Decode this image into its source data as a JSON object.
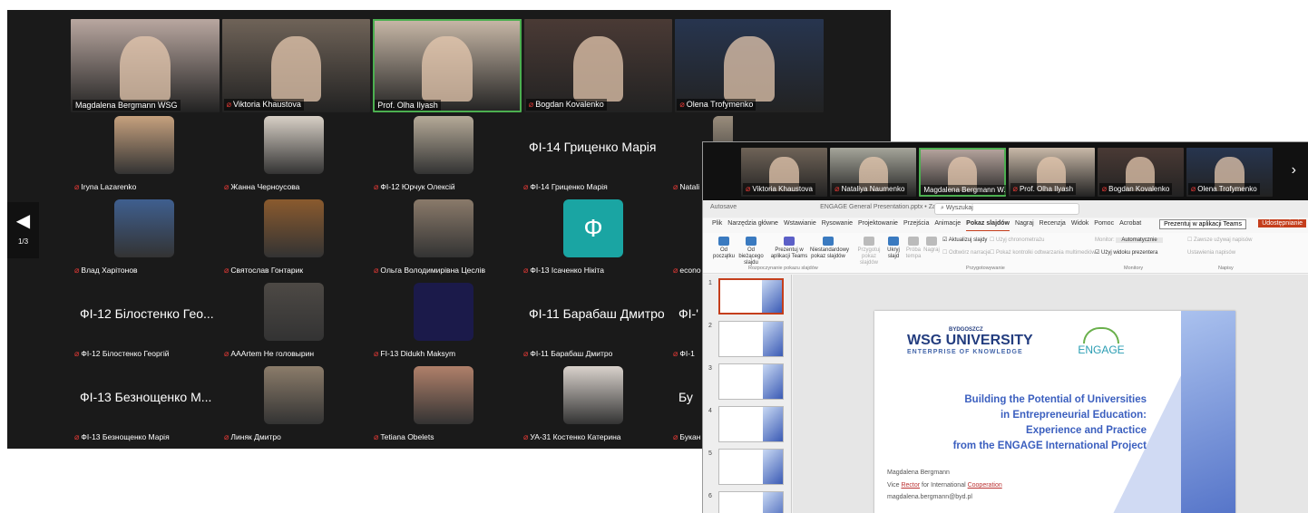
{
  "zoom_call": {
    "pager": "1/3",
    "top_row": [
      {
        "name": "Magdalena Bergmann WSG",
        "muted": false,
        "active": false,
        "bg": "#b9a7a0"
      },
      {
        "name": "Viktoria Khaustova",
        "muted": true,
        "active": false,
        "bg": "#6f6358"
      },
      {
        "name": "Prof. Olha Ilyash",
        "muted": false,
        "active": true,
        "bg": "#c9b9a8"
      },
      {
        "name": "Bogdan Kovalenko",
        "muted": true,
        "active": false,
        "bg": "#4a3a35"
      },
      {
        "name": "Olena Trofymenko",
        "muted": true,
        "active": false,
        "bg": "#27354f"
      }
    ],
    "grid": [
      {
        "label": "Iryna Lazarenko",
        "big": "",
        "photo": "#c6a17e"
      },
      {
        "label": "Жанна Черноусова",
        "big": "",
        "photo": "#d8d0c6"
      },
      {
        "label": "ФІ-12 Юрчук Олексій",
        "big": "",
        "photo": "#b5aa98"
      },
      {
        "label": "ФІ-14 Гриценко Марія",
        "big": "ФІ-14 Гриценко Марія",
        "photo": ""
      },
      {
        "label": "Natali",
        "big": "",
        "photo": "#9a8d7c"
      },
      {
        "label": "Влад Харітонов",
        "big": "",
        "photo": "#3f5f8f"
      },
      {
        "label": "Святослав Гонтарик",
        "big": "",
        "photo": "#8a5a2e"
      },
      {
        "label": "Ольга Володимирівна Цеслів",
        "big": "",
        "photo": "#8a7a6a"
      },
      {
        "label": "ФІ-13 Ісаченко Нікіта",
        "big": "",
        "photo": "teal"
      },
      {
        "label": "econo",
        "big": "",
        "photo": ""
      },
      {
        "label": "ФІ-12 Білостенко Георгій",
        "big": "ФІ-12 Білостенко Гео...",
        "photo": ""
      },
      {
        "label": "AAArtem Не головырин",
        "big": "",
        "photo": "#4d4945"
      },
      {
        "label": "FI-13 Didukh Maksym",
        "big": "",
        "photo": "navy"
      },
      {
        "label": "ФІ-11 Барабаш Дмитро",
        "big": "ФІ-11 Барабаш Дмитро",
        "photo": ""
      },
      {
        "label": "ФІ-1",
        "big": "ФІ-'",
        "photo": ""
      },
      {
        "label": "ФІ-13 Безнощенко Марія",
        "big": "ФІ-13 Безнощенко М...",
        "photo": ""
      },
      {
        "label": "Линяк Дмитро",
        "big": "",
        "photo": "#8b7c6a"
      },
      {
        "label": "Tetiana Obelets",
        "big": "",
        "photo": "#b0806a"
      },
      {
        "label": "УА-31 Костенко Катерина",
        "big": "",
        "photo": "#d9d2cc"
      },
      {
        "label": "Букан",
        "big": "Бу",
        "photo": ""
      }
    ],
    "teal_letter": "Ф"
  },
  "powerpoint": {
    "strip": [
      {
        "name": "Viktoria Khaustova",
        "muted": true,
        "active": false,
        "bg": "#6f6358"
      },
      {
        "name": "Nataliya Naumenko",
        "muted": true,
        "active": false,
        "bg": "#a5a59a"
      },
      {
        "name": "Magdalena Bergmann W...",
        "muted": false,
        "active": true,
        "bg": "#b9a7a0"
      },
      {
        "name": "Prof. Olha Ilyash",
        "muted": true,
        "active": false,
        "bg": "#c9b9a8"
      },
      {
        "name": "Bogdan Kovalenko",
        "muted": true,
        "active": false,
        "bg": "#4a3a35"
      },
      {
        "name": "Olena Trofymenko",
        "muted": true,
        "active": false,
        "bg": "#27354f"
      }
    ],
    "title_left": "Autosave",
    "title_file": "ENGAGE General Presentation.pptx • Zapisano",
    "search": "Wyszukaj",
    "menu": [
      "Plik",
      "Narzędzia główne",
      "Wstawianie",
      "Rysowanie",
      "Projektowanie",
      "Przejścia",
      "Animacje",
      "Pokaz slajdów",
      "Nagraj",
      "Recenzja",
      "Widok",
      "Pomoc",
      "Acrobat"
    ],
    "menu_selected": "Pokaz slajdów",
    "teams_button": "Prezentuj w aplikacji Teams",
    "share_button": "Udostępnianie",
    "ribbon": {
      "from_start": "Od początku",
      "from_current": "Od bieżącego slajdu",
      "present_teams": "Prezentuj w aplikacji Teams",
      "custom_show": "Niestandardowy pokaz slajdów",
      "setup": "Przygotuj pokaz slajdów",
      "hide": "Ukryj slajd",
      "rehearse": "Próba tempa",
      "record": "Nagraj",
      "cb_refresh": "Aktualizuj slajdy",
      "cb_narration": "Odtwórz narracje",
      "cb_timings": "Użyj chronometrażu",
      "cb_controls": "Pokaż kontrolki odtwarzania multimediów",
      "monitor_label": "Monitor:",
      "monitor_value": "Automatycznie",
      "presenter_view": "Użyj widoku prezentera",
      "subtitles": "Zawsze używaj napisów",
      "subtitle_settings": "Ustawienia napisów",
      "group1": "Rozpoczynanie pokazu slajdów",
      "group2": "Przygotowywanie",
      "group3": "Monitory",
      "group4": "Napisy"
    },
    "thumb_numbers": [
      "1",
      "2",
      "3",
      "4",
      "5",
      "6"
    ],
    "slide": {
      "logo_small": "BYDGOSZCZ",
      "logo_main": "WSG UNIVERSITY",
      "logo_tag": "ENTERPRISE OF KNOWLEDGE",
      "engage": "ENGAGE",
      "title_lines": [
        "Building the Potential of Universities",
        "in Entrepreneurial Education:",
        "Experience and Practice",
        "from the ENGAGE International Project"
      ],
      "author": "Magdalena Bergmann",
      "role_pre": "Vice ",
      "role_u1": "Rector",
      "role_mid": " for International ",
      "role_u2": "Cooperation",
      "email": "magdalena.bergmann@byd.pl"
    }
  }
}
